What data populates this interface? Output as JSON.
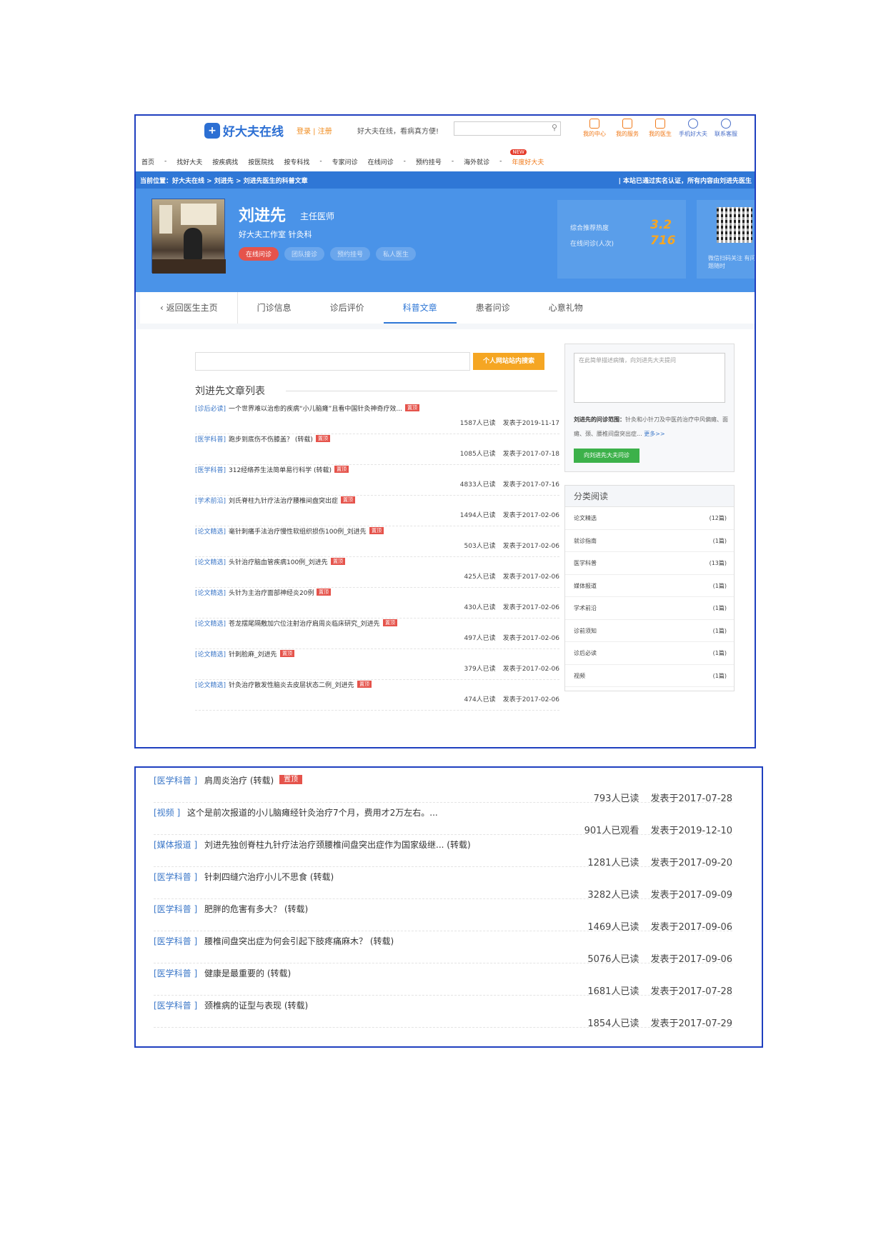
{
  "header": {
    "logo_text": "好大夫在线",
    "login_links": "登录 | 注册",
    "slogan": "好大夫在线，看病真方便!",
    "quick_links": [
      "我的中心",
      "我的服务",
      "我的医生",
      "手机好大夫",
      "联系客服"
    ]
  },
  "nav": {
    "items": [
      "首页",
      "-",
      "找好大夫",
      "按疾病找",
      "按医院找",
      "按专科找",
      "-",
      "专家问诊",
      "在线问诊",
      "-",
      "预约挂号",
      "-",
      "海外就诊",
      "-",
      "年度好大夫"
    ],
    "new_badge": "NEW"
  },
  "breadcrumb": {
    "left": "当前位置：好大夫在线 > 刘进先 > 刘进先医生的科普文章",
    "right": "| 本站已通过实名认证，所有内容由刘进先医生"
  },
  "doctor": {
    "name": "刘进先",
    "title": "主任医师",
    "dept": "好大夫工作室  针灸科",
    "buttons": [
      "在线问诊",
      "团队接诊",
      "预约挂号",
      "私人医生"
    ]
  },
  "stats": {
    "recommend_label": "综合推荐热度",
    "recommend_value": "3.2",
    "consult_label": "在线问诊(人次)",
    "consult_value": "716"
  },
  "qr": {
    "text": "微信扫码关注 有问题随时"
  },
  "tabs": [
    "返回医生主页",
    "门诊信息",
    "诊后评价",
    "科普文章",
    "患者问诊",
    "心意礼物"
  ],
  "search": {
    "button": "个人网站站内搜索"
  },
  "list_title": "刘进先文章列表",
  "articles": [
    {
      "cat": "[诊后必读]",
      "title": "一个世界难以治愈的疾病“小儿脑瘫”且看中国针灸神奇疗效...",
      "tag": "置顶",
      "reads": "1587人已读",
      "date": "发表于2019-11-17"
    },
    {
      "cat": "[医学科普]",
      "title": "跑步到底伤不伤膝盖？  (转载)",
      "tag": "置顶",
      "reads": "1085人已读",
      "date": "发表于2017-07-18"
    },
    {
      "cat": "[医学科普]",
      "title": "312经络养生法简单易行科学  (转载)",
      "tag": "置顶",
      "reads": "4833人已读",
      "date": "发表于2017-07-16"
    },
    {
      "cat": "[学术前沿]",
      "title": "刘氏脊柱九针疗法治疗腰椎间盘突出症",
      "tag": "置顶",
      "reads": "1494人已读",
      "date": "发表于2017-02-06"
    },
    {
      "cat": "[论文精选]",
      "title": "毫针刺痛手法治疗慢性软组织损伤100例_刘进先",
      "tag": "置顶",
      "reads": "503人已读",
      "date": "发表于2017-02-06"
    },
    {
      "cat": "[论文精选]",
      "title": "头针治疗脑血管疾病100例_刘进先",
      "tag": "置顶",
      "reads": "425人已读",
      "date": "发表于2017-02-06"
    },
    {
      "cat": "[论文精选]",
      "title": "头针为主治疗面部神经炎20例",
      "tag": "置顶",
      "reads": "430人已读",
      "date": "发表于2017-02-06"
    },
    {
      "cat": "[论文精选]",
      "title": "苍龙摆尾隔敷加穴位注射治疗肩周炎临床研究_刘进先",
      "tag": "置顶",
      "reads": "497人已读",
      "date": "发表于2017-02-06"
    },
    {
      "cat": "[论文精选]",
      "title": "针刺脸麻_刘进先",
      "tag": "置顶",
      "reads": "379人已读",
      "date": "发表于2017-02-06"
    },
    {
      "cat": "[论文精选]",
      "title": "针灸治疗散发性脑炎去皮层状态二例_刘进先",
      "tag": "置顶",
      "reads": "474人已读",
      "date": "发表于2017-02-06"
    }
  ],
  "ask": {
    "placeholder": "在此简单描述病情，向刘进先大夫提问",
    "scope_label": "刘进先的问诊范围：",
    "scope_text": "针灸和小针刀及中医药治疗中风偏瘫、面瘫、颈、腰椎间盘突出症...",
    "more": "更多>>",
    "button": "向刘进先大夫问诊"
  },
  "categories": {
    "title": "分类阅读",
    "items": [
      {
        "name": "论文精选",
        "count": "(12篇)"
      },
      {
        "name": "就诊指南",
        "count": "(1篇)"
      },
      {
        "name": "医学科普",
        "count": "(13篇)"
      },
      {
        "name": "媒体报道",
        "count": "(1篇)"
      },
      {
        "name": "学术前沿",
        "count": "(1篇)"
      },
      {
        "name": "诊前须知",
        "count": "(1篇)"
      },
      {
        "name": "诊后必读",
        "count": "(1篇)"
      },
      {
        "name": "视频",
        "count": "(1篇)"
      }
    ]
  },
  "articles2": [
    {
      "cat": "[医学科普 ]",
      "title": "肩周炎治疗  (转载)",
      "tag": "置顶",
      "reads": "793人已读",
      "date": "发表于2017-07-28"
    },
    {
      "cat": "[视频 ]",
      "title": "这个是前次报道的小儿脑瘫经针灸治疗7个月，费用才2万左右。...",
      "tag": "",
      "reads": "901人已观看",
      "date": "发表于2019-12-10"
    },
    {
      "cat": "[媒体报道 ]",
      "title": "刘进先独创脊柱九针疗法治疗颈腰椎间盘突出症作为国家级继...  (转载)",
      "tag": "",
      "reads": "1281人已读",
      "date": "发表于2017-09-20"
    },
    {
      "cat": "[医学科普 ]",
      "title": "针刺四缝穴治疗小儿不思食  (转载)",
      "tag": "",
      "reads": "3282人已读",
      "date": "发表于2017-09-09"
    },
    {
      "cat": "[医学科普 ]",
      "title": "肥胖的危害有多大？  (转载)",
      "tag": "",
      "reads": "1469人已读",
      "date": "发表于2017-09-06"
    },
    {
      "cat": "[医学科普 ]",
      "title": "腰椎间盘突出症为何会引起下肢疼痛麻木？  (转载)",
      "tag": "",
      "reads": "5076人已读",
      "date": "发表于2017-09-06"
    },
    {
      "cat": "[医学科普 ]",
      "title": "健康是最重要的  (转载)",
      "tag": "",
      "reads": "1681人已读",
      "date": "发表于2017-07-28"
    },
    {
      "cat": "[医学科普 ]",
      "title": "颈椎病的证型与表现  (转载)",
      "tag": "",
      "reads": "1854人已读",
      "date": "发表于2017-07-29"
    }
  ]
}
